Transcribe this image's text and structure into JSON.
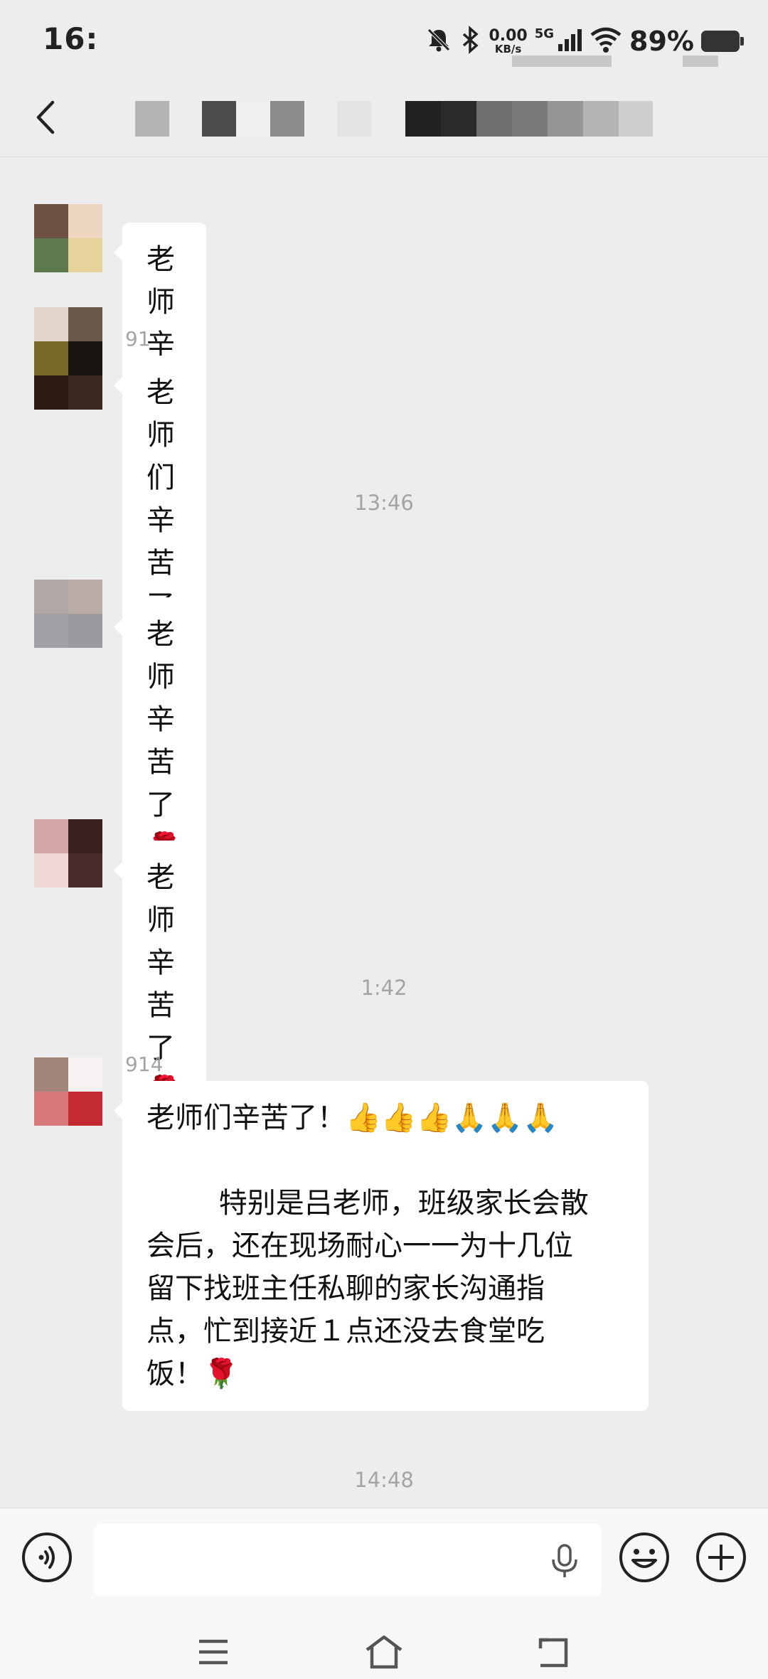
{
  "status_bar": {
    "time": "16:",
    "net_speed_value": "0.00",
    "net_speed_unit": "KB/s",
    "network_type": "5G",
    "battery": "89%"
  },
  "header": {
    "back_icon": "chevron-left-icon"
  },
  "messages": [
    {
      "sender": "",
      "text": "老师辛苦了🌹"
    },
    {
      "sender": "91",
      "text": "老师们辛苦了🌹"
    },
    {
      "sender": "",
      "text": "老师辛苦了🌹"
    },
    {
      "sender": "",
      "text": "老师辛苦了🌹"
    },
    {
      "sender": "914",
      "text": "老师们辛苦了！👍👍👍🙏🙏🙏\n\n        特别是吕老师，班级家长会散\n会后，还在现场耐心一一为十几位\n留下找班主任私聊的家长沟通指\n点，忙到接近１点还没去食堂吃\n饭！🌹"
    }
  ],
  "timestamps": [
    "13:46",
    "",
    "1:42",
    "14:48"
  ],
  "input_bar": {
    "placeholder": "",
    "voice_icon": "voice-input-icon",
    "mic_icon": "microphone-icon",
    "emoji_icon": "emoji-icon",
    "plus_icon": "plus-icon"
  },
  "nav_bar": {
    "menu_icon": "menu-icon",
    "home_icon": "home-icon",
    "back_icon": "back-icon"
  },
  "colors": {
    "chat_background": "#ededed",
    "bubble": "#ffffff",
    "timestamp": "#a4a4a4"
  }
}
